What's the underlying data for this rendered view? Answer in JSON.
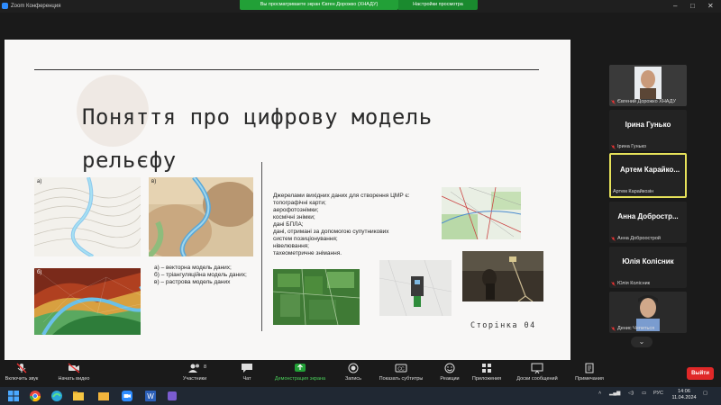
{
  "titlebar": {
    "app_title": "Zoom Конференция",
    "share_banner": "Вы просматриваете экран Євген Дорожко (ХНАДУ)",
    "view_settings": "Настройки просмотра"
  },
  "slide": {
    "title_line1": "Поняття про цифрову модель",
    "title_line2": "рельєфу",
    "label_a": "а)",
    "label_b": "в)",
    "label_c": "б)",
    "captions": [
      "а) – векторна модель даних;",
      "б) – тріангуляційна модель даних;",
      "в) – растрова модель даних"
    ],
    "sources": [
      "Джерелами вихідних даних для створення ЦМР є:",
      "топографічні карти;",
      "аерофотознімки;",
      "космічні знімки;",
      "дані БПЛА;",
      "дані, отримані за допомогою супутникових",
      "систем позиціонування;",
      "нівелювання;",
      "тахеометричне знімання."
    ],
    "page_number": "Сторінка 04"
  },
  "participants": [
    {
      "name": "",
      "sub": "Євгений Дорожко ХНАДУ",
      "has_video": true
    },
    {
      "name": "Ірина Гунько",
      "sub": "Ірина Гунько",
      "has_video": false
    },
    {
      "name": "Артем Карайко...",
      "sub": "Артем Карайкозін",
      "has_video": false,
      "active": true
    },
    {
      "name": "Анна Добростр...",
      "sub": "Анна Доброострой",
      "has_video": false
    },
    {
      "name": "Юлія Колісник",
      "sub": "Юлія Колісник",
      "has_video": false
    },
    {
      "name": "",
      "sub": "Денис Чепиться",
      "has_video": true
    }
  ],
  "toolbar": {
    "audio": "Включить звук",
    "video": "Начать видео",
    "participants": "Участники",
    "participants_count": "8",
    "chat": "Чат",
    "share": "Демонстрация экрана",
    "record": "Запись",
    "subtitles": "Показать субтитры",
    "reactions": "Реакции",
    "apps": "Приложения",
    "whiteboards": "Доски сообщений",
    "notes": "Примечания",
    "leave": "Выйти"
  },
  "taskbar": {
    "lang": "РУС",
    "time": "14:06",
    "date": "11.04.2024"
  },
  "colors": {
    "share_green": "#22a037",
    "leave_red": "#e02828",
    "active_border": "#e7e25a"
  }
}
